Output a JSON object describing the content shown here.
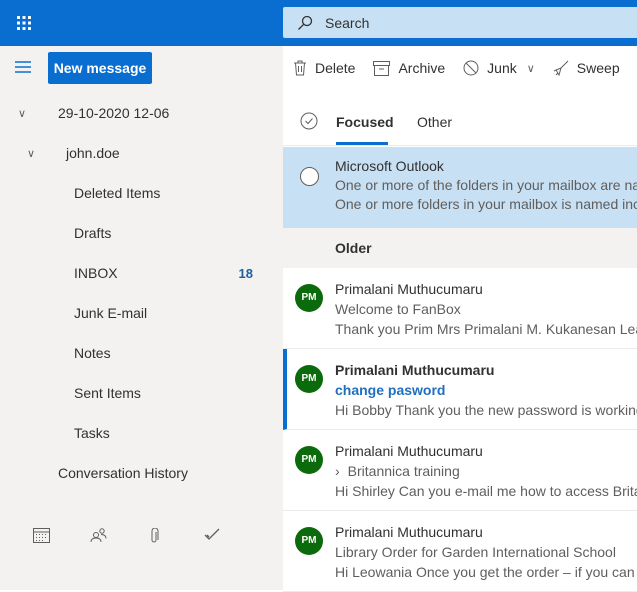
{
  "header": {
    "search_placeholder": "Search"
  },
  "sidebar": {
    "new_message": "New message",
    "account": "29-10-2020 12-06",
    "user": "john.doe",
    "folders": [
      {
        "label": "Deleted Items"
      },
      {
        "label": "Drafts"
      },
      {
        "label": "INBOX",
        "count": "18"
      },
      {
        "label": "Junk E-mail"
      },
      {
        "label": "Notes"
      },
      {
        "label": "Sent Items"
      },
      {
        "label": "Tasks"
      }
    ],
    "conversation_history": "Conversation History",
    "bottom_icons": [
      "calendar-icon",
      "people-icon",
      "paperclip-icon",
      "checkmark-icon"
    ]
  },
  "toolbar": {
    "delete": "Delete",
    "archive": "Archive",
    "junk": "Junk",
    "sweep": "Sweep"
  },
  "tabs": {
    "focused": "Focused",
    "other": "Other"
  },
  "system_message": {
    "sender": "Microsoft Outlook",
    "line1": "One or more of the folders in your mailbox are named incorrectly",
    "line2": "One or more folders in your mailbox is named incorrectly"
  },
  "section": "Older",
  "messages": [
    {
      "initials": "PM",
      "sender": "Primalani Muthucumaru",
      "subject": "Welcome to FanBox",
      "preview": "Thank you Prim Mrs Primalani M. Kukanesan Learning"
    },
    {
      "initials": "PM",
      "sender": "Primalani Muthucumaru",
      "subject": "change pasword",
      "preview": "Hi Bobby Thank you the new password is working"
    },
    {
      "initials": "PM",
      "sender": "Primalani Muthucumaru",
      "subject": "Britannica training",
      "preview": "Hi Shirley Can you e-mail me how to access Britannica"
    },
    {
      "initials": "PM",
      "sender": "Primalani Muthucumaru",
      "subject": "Library Order for Garden International School",
      "preview": "Hi Leowania Once you get the order – if you can"
    }
  ],
  "colors": {
    "accent": "#0a6ed1",
    "avatar": "#0b6a0b",
    "selected_bg": "#c7e0f4"
  }
}
